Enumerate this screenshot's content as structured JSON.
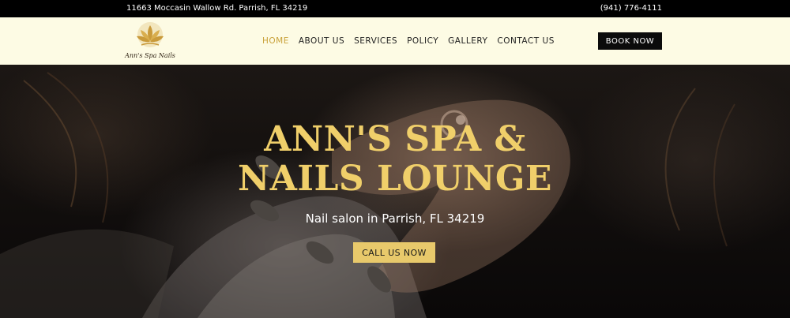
{
  "topbar": {
    "address": "11663 Moccasin Wallow Rd. Parrish, FL 34219",
    "phone": "(941) 776-4111"
  },
  "logo": {
    "text": "Ann's Spa Nails",
    "icon": "lotus-icon"
  },
  "nav": {
    "items": [
      {
        "label": "HOME",
        "active": true
      },
      {
        "label": "ABOUT US"
      },
      {
        "label": "SERVICES"
      },
      {
        "label": "POLICY"
      },
      {
        "label": "GALLERY"
      },
      {
        "label": "CONTACT US"
      }
    ],
    "book_label": "BOOK NOW"
  },
  "hero": {
    "title_line1": "ANN'S SPA &",
    "title_line2": "NAILS LOUNGE",
    "subtitle": "Nail salon in Parrish, FL 34219",
    "cta_label": "CALL US NOW"
  },
  "colors": {
    "accent_gold": "#f0cf6a",
    "button_gold": "#e8c96b",
    "nav_bg": "#fdfbe4",
    "topbar_bg": "#000000"
  }
}
